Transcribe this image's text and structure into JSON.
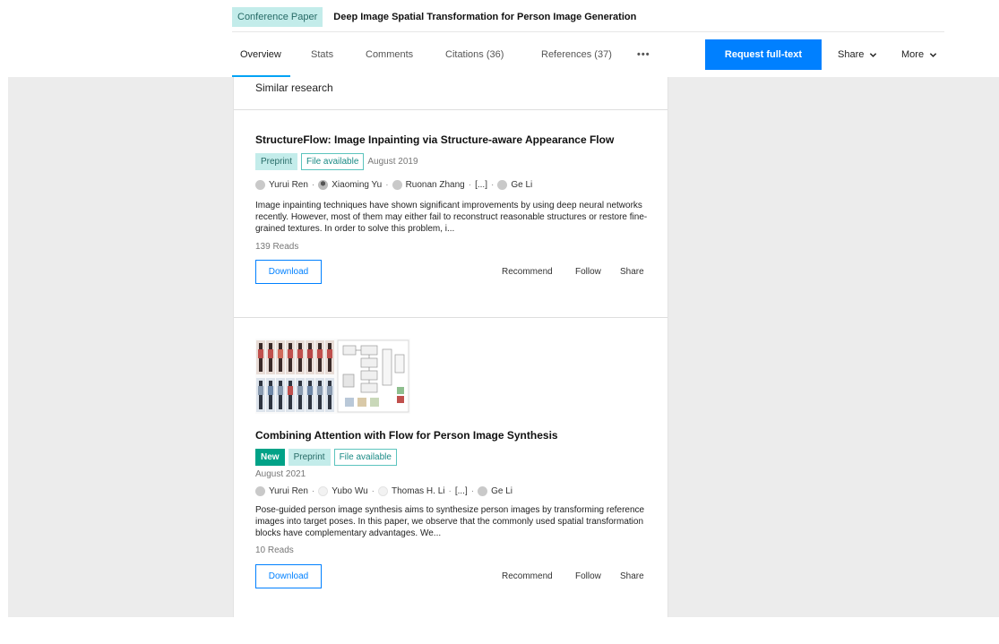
{
  "header": {
    "type_badge": "Conference Paper",
    "title": "Deep Image Spatial Transformation for Person Image Generation",
    "tabs": [
      {
        "label": "Overview",
        "active": true
      },
      {
        "label": "Stats"
      },
      {
        "label": "Comments"
      },
      {
        "label": "Citations (36)"
      },
      {
        "label": "References (37)"
      },
      {
        "label": "•••"
      }
    ],
    "request_button": "Request full-text",
    "share_menu": "Share",
    "more_menu": "More"
  },
  "section": {
    "title": "Similar research"
  },
  "items": [
    {
      "title": "StructureFlow: Image Inpainting via Structure-aware Appearance Flow",
      "badges": [
        "Preprint",
        "File available"
      ],
      "date": "August 2019",
      "authors": [
        "Yurui Ren",
        "Xiaoming Yu",
        "Ruonan Zhang",
        "[...]",
        "Ge Li"
      ],
      "abstract": "Image inpainting techniques have shown significant improvements by using deep neural networks recently. However, most of them may either fail to reconstruct reasonable structures or restore fine-grained textures. In order to solve this problem, i...",
      "reads": "139 Reads",
      "download": "Download",
      "recommend": "Recommend",
      "follow": "Follow",
      "share": "Share"
    },
    {
      "title": "Combining Attention with Flow for Person Image Synthesis",
      "badges": [
        "New",
        "Preprint",
        "File available"
      ],
      "date": "August 2021",
      "authors": [
        "Yurui Ren",
        "Yubo Wu",
        "Thomas H. Li",
        "[...]",
        "Ge Li"
      ],
      "abstract": "Pose-guided person image synthesis aims to synthesize person images by transforming reference images into target poses. In this paper, we observe that the commonly used spatial transformation blocks have complementary advantages. We...",
      "reads": "10 Reads",
      "download": "Download",
      "recommend": "Recommend",
      "follow": "Follow",
      "share": "Share"
    }
  ],
  "colors": {
    "accent": "#0080ff",
    "tab_underline": "#00a3f5",
    "badge_teal_bg": "#c3ecea",
    "badge_new": "#00a287",
    "page_bg": "#ececec"
  }
}
